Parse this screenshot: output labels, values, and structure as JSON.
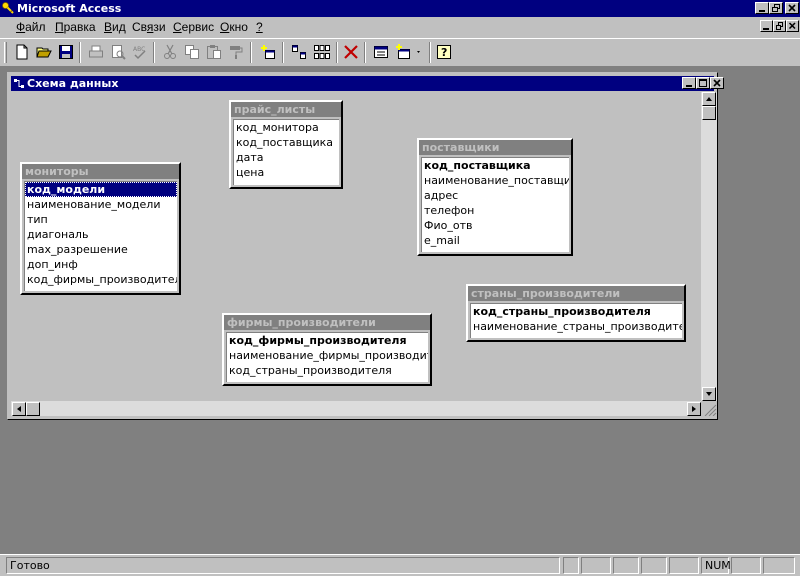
{
  "app": {
    "title": "Microsoft Access"
  },
  "menu": {
    "items": [
      {
        "ul": "Ф",
        "rest": "айл"
      },
      {
        "ul": "П",
        "rest": "равка"
      },
      {
        "ul": "В",
        "rest": "ид"
      },
      {
        "pre": "Св",
        "ul": "я",
        "rest": "зи"
      },
      {
        "ul": "С",
        "rest": "ервис"
      },
      {
        "ul": "О",
        "rest": "кно"
      },
      {
        "ul": "?",
        "rest": ""
      }
    ]
  },
  "toolbar": {
    "buttons": [
      "new-icon",
      "open-icon",
      "save-icon",
      "print-icon",
      "print-preview-icon",
      "spelling-icon",
      "cut-icon",
      "copy-icon",
      "paste-icon",
      "format-painter-icon",
      "show-table-icon",
      "show-direct-icon",
      "show-all-icon",
      "delete-icon",
      "properties-icon",
      "new-object-icon",
      "help-icon"
    ]
  },
  "schema_window": {
    "title": "Схема данных",
    "tables": [
      {
        "name": "прайс_листы",
        "fields": [
          "код_монитора",
          "код_поставщика",
          "дата",
          "цена"
        ]
      },
      {
        "name": "поставщики",
        "fields": [
          "код_поставщика",
          "наименование_поставщика",
          "адрес",
          "телефон",
          "Фио_отв",
          "e_mail"
        ]
      },
      {
        "name": "мониторы",
        "fields": [
          "код_модели",
          "наименование_модели",
          "тип",
          "диагональ",
          "max_разрешение",
          "доп_инф",
          "код_фирмы_производителя"
        ]
      },
      {
        "name": "страны_производители",
        "fields": [
          "код_страны_производителя",
          "наименование_страны_производителя"
        ]
      },
      {
        "name": "фирмы_производители",
        "fields": [
          "код_фирмы_производителя",
          "наименование_фирмы_производителя",
          "код_страны_производителя"
        ]
      }
    ]
  },
  "status": {
    "text": "Готово",
    "num": "NUM"
  },
  "colors": {
    "title_bar": "#000080",
    "face": "#c0c0c0",
    "mdi_background": "#808080",
    "table_header": "#808080"
  }
}
